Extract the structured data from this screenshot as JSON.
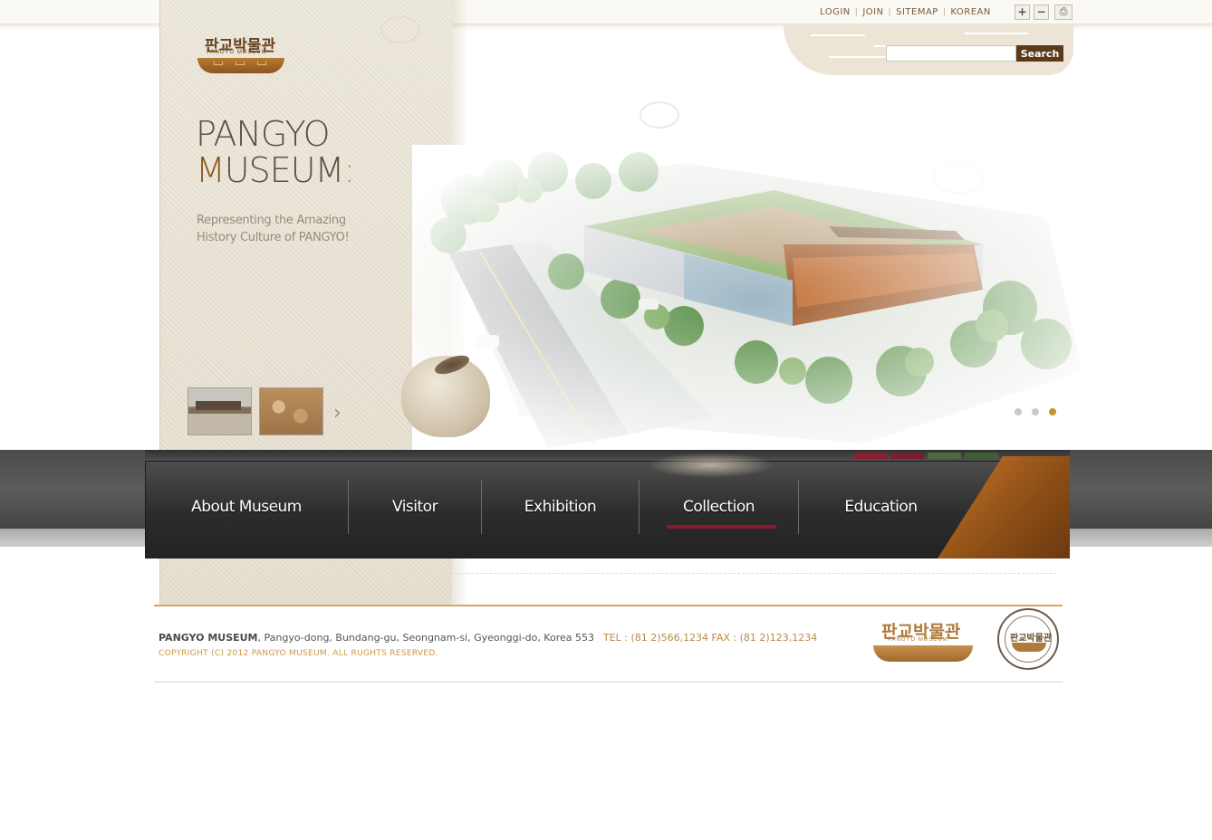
{
  "util_nav": {
    "login": "LOGIN",
    "join": "JOIN",
    "sitemap": "SITEMAP",
    "korean": "KOREAN",
    "sep": "|"
  },
  "util_buttons": {
    "zoom_in": "+",
    "zoom_out": "−",
    "print": "⎙"
  },
  "search": {
    "placeholder": "",
    "button": "Search"
  },
  "logo": {
    "korean": "판교박물관",
    "english": "PANGYO MUSEUM"
  },
  "hero": {
    "title_line1": "PANGYO",
    "title_line2_first": "M",
    "title_line2_rest": "USEUM",
    "title_dot": ":",
    "subtitle_line1": "Representing the Amazing",
    "subtitle_line2": "History Culture of PANGYO!",
    "next_arrow": "›"
  },
  "slider": {
    "count": 3,
    "active_index": 2
  },
  "nav": {
    "items": [
      {
        "label": "About Museum",
        "active": false
      },
      {
        "label": "Visitor",
        "active": false
      },
      {
        "label": "Exhibition",
        "active": false
      },
      {
        "label": "Collection",
        "active": true
      },
      {
        "label": "Education",
        "active": false
      }
    ]
  },
  "colors": {
    "accent_bars": [
      "#8a1f33",
      "#7a1e2e",
      "#4d6b3c",
      "#3f5e34"
    ],
    "active_underline": "#8a1a2e",
    "brand_brown": "#6a4320",
    "corner_orange": "#b86a22"
  },
  "footer": {
    "name": "PANGYO MUSEUM",
    "address": ", Pangyo-dong, Bundang-gu, Seongnam-si, Gyeonggi-do, Korea 553",
    "tel": "TEL : (81 2)566,1234   FAX : (81 2)123,1234",
    "copyright": "COPYRIGHT (C) 2012 PANGYO MUSEUM. ALL RUGHTS RESERVED.",
    "logo_korean": "판교박물관",
    "logo_english": "PANGYO MUSEUM",
    "seal_korean": "판교박물관"
  }
}
